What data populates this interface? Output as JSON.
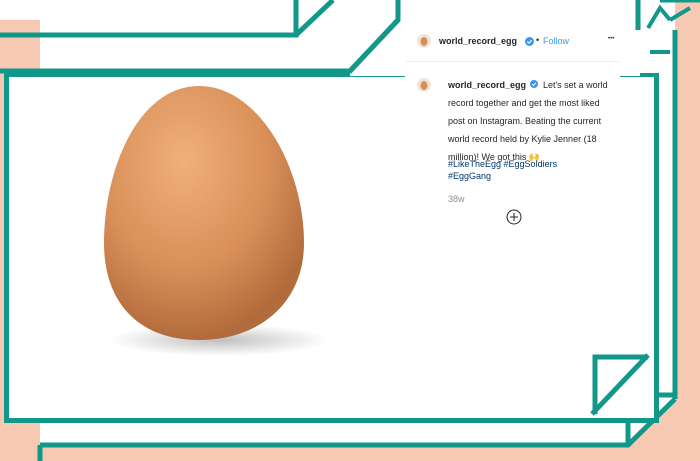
{
  "post": {
    "username": "world_record_egg",
    "follow_label": "Follow",
    "more_label": "•••",
    "caption_user": "world_record_egg",
    "caption_text": "Let's set a world record together and get the most liked post on Instagram. Beating the current world record held by Kylie Jenner (18 million)! We got this 🙌",
    "hashtags": "#LikeTheEgg #EggSoldiers #EggGang",
    "age": "38w"
  },
  "colors": {
    "frame": "#11988a",
    "background": "#f7c9b3",
    "egg": "#d98f58",
    "verified": "#3897f0",
    "link": "#00376b"
  }
}
